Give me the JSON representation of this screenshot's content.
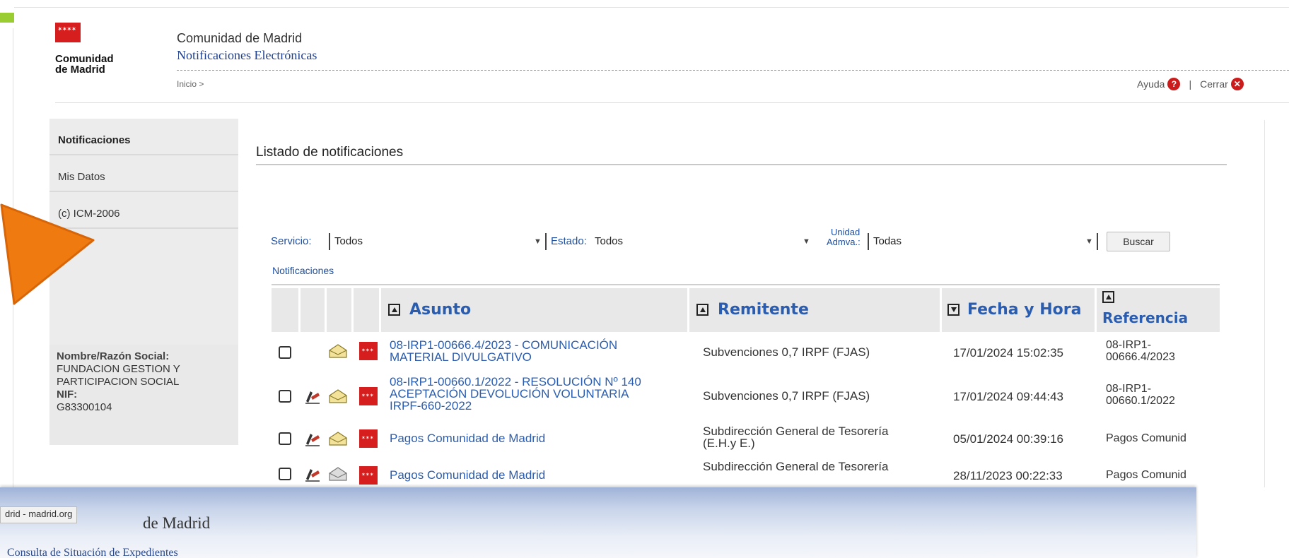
{
  "header": {
    "logo_text": "Comunidad de Madrid",
    "logo_line1": "Comunidad",
    "logo_line2": "de Madrid",
    "title": "Comunidad de Madrid",
    "subtitle": "Notificaciones Electrónicas",
    "breadcrumb": "Inicio >",
    "help_label": "Ayuda",
    "close_label": "Cerrar",
    "separator": "|"
  },
  "sidebar": {
    "items": [
      {
        "label": "Notificaciones",
        "active": true
      },
      {
        "label": "Mis Datos",
        "active": false
      },
      {
        "label": "(c) ICM-2006",
        "active": false
      }
    ],
    "entity_label": "Nombre/Razón Social:",
    "entity_name_1": "FUNDACION GESTION Y",
    "entity_name_2": "PARTICIPACION SOCIAL",
    "nif_label": "NIF:",
    "nif_value": "G83300104"
  },
  "main": {
    "title": "Listado de notificaciones",
    "filters": {
      "servicio_label": "Servicio:",
      "servicio_value": "Todos",
      "estado_label": "Estado:",
      "estado_value": "Todos",
      "unidad_label_1": "Unidad",
      "unidad_label_2": "Admva.:",
      "unidad_value": "Todas",
      "search_button": "Buscar"
    },
    "notifications_label": "Notificaciones",
    "columns": {
      "asunto": "Asunto",
      "remitente": "Remitente",
      "fecha": "Fecha y Hora",
      "referencia": "Referencia"
    },
    "rows": [
      {
        "asunto_1": "08-IRP1-00666.4/2023 - COMUNICACIÓN",
        "asunto_2": "MATERIAL DIVULGATIVO",
        "asunto_3": "",
        "remitente_1": "Subvenciones 0,7 IRPF (FJAS)",
        "remitente_2": "",
        "fecha": "17/01/2024 15:02:35",
        "referencia_1": "08-IRP1-",
        "referencia_2": "00666.4/2023",
        "signed": false
      },
      {
        "asunto_1": "08-IRP1-00660.1/2022 - RESOLUCIÓN Nº 140",
        "asunto_2": "ACEPTACIÓN DEVOLUCIÓN VOLUNTARIA",
        "asunto_3": "IRPF-660-2022",
        "remitente_1": "Subvenciones 0,7 IRPF (FJAS)",
        "remitente_2": "",
        "fecha": "17/01/2024 09:44:43",
        "referencia_1": "08-IRP1-",
        "referencia_2": "00660.1/2022",
        "signed": true
      },
      {
        "asunto_1": "Pagos Comunidad de Madrid",
        "asunto_2": "",
        "asunto_3": "",
        "remitente_1": "Subdirección General de Tesorería",
        "remitente_2": "(E.H.y E.)",
        "fecha": "05/01/2024 00:39:16",
        "referencia_1": "Pagos Comunid",
        "referencia_2": "",
        "signed": true
      },
      {
        "asunto_1": "Pagos Comunidad de Madrid",
        "asunto_2": "",
        "asunto_3": "",
        "remitente_1": "Subdirección General de Tesorería",
        "remitente_2": "",
        "fecha": "28/11/2023 00:22:33",
        "referencia_1": "Pagos Comunid",
        "referencia_2": "",
        "signed": true
      }
    ]
  },
  "popup": {
    "tab_label": "drid - madrid.org",
    "title": "de Madrid",
    "subtitle": "Consulta de Situación de Expedientes"
  },
  "colors": {
    "brand_red": "#d61e1e",
    "link_blue": "#2a5db0",
    "orange_arrow": "#ee7a10",
    "lime": "#9acd32"
  }
}
